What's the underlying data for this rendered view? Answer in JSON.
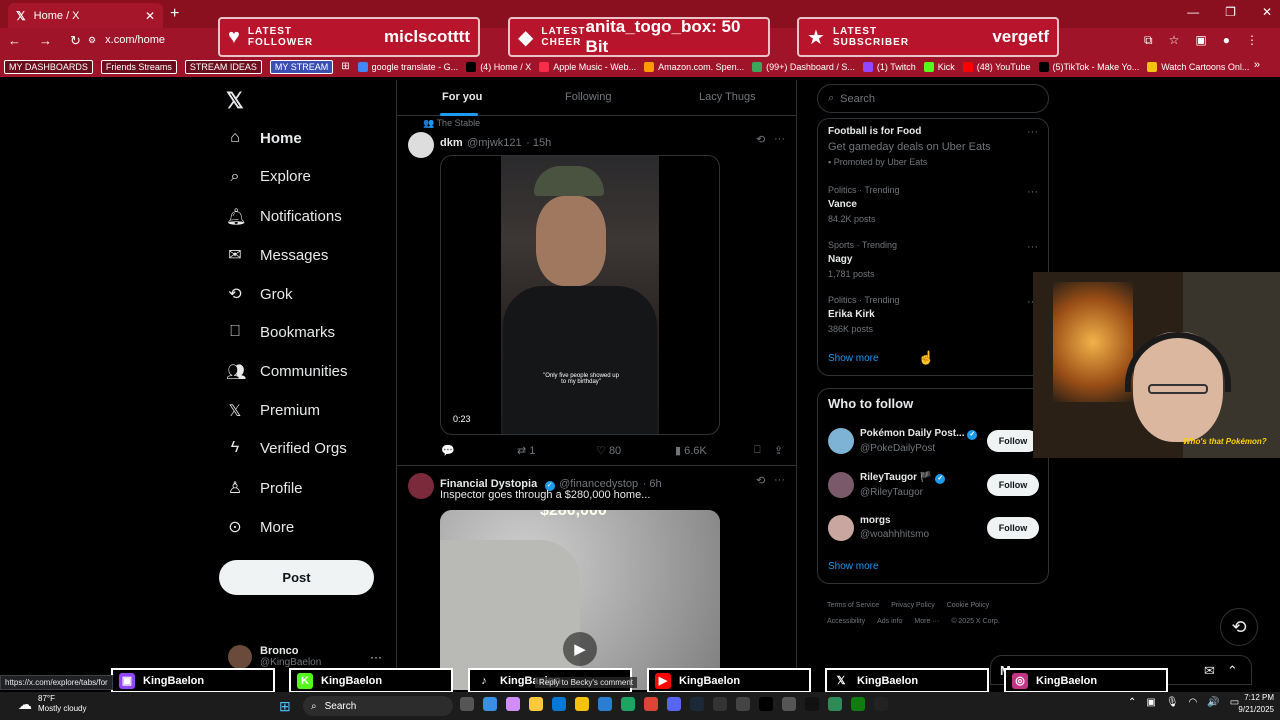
{
  "browser": {
    "tab_title": "Home / X",
    "url": "x.com/home",
    "bookmarks": [
      {
        "label": "MY DASHBOARDS",
        "kind": "tag"
      },
      {
        "label": "Friends Streams",
        "kind": "tag"
      },
      {
        "label": "STREAM IDEAS",
        "kind": "tag"
      },
      {
        "label": "MY STREAM",
        "kind": "tag-blue"
      },
      {
        "label": "google translate - G...",
        "kind": "link",
        "color": "#4285f4"
      },
      {
        "label": "(4) Home / X",
        "kind": "link",
        "color": "#000000"
      },
      {
        "label": "Apple Music - Web...",
        "kind": "link",
        "color": "#fa2d48"
      },
      {
        "label": "Amazon.com. Spen...",
        "kind": "link",
        "color": "#ff9900"
      },
      {
        "label": "(99+) Dashboard / S...",
        "kind": "link",
        "color": "#3ba55c"
      },
      {
        "label": "(1) Twitch",
        "kind": "link",
        "color": "#9146ff"
      },
      {
        "label": "Kick",
        "kind": "link",
        "color": "#53fc18"
      },
      {
        "label": "(48) YouTube",
        "kind": "link",
        "color": "#ff0000"
      },
      {
        "label": "(5)TikTok - Make Yo...",
        "kind": "link",
        "color": "#000000"
      },
      {
        "label": "Watch Cartoons Onl...",
        "kind": "link",
        "color": "#f4c20d"
      }
    ]
  },
  "overlay": {
    "alerts": [
      {
        "top": "LATEST",
        "bottom": "FOLLOWER",
        "name": "miclscotttt",
        "icon": "heart-icon"
      },
      {
        "top": "LATEST",
        "bottom": "CHEER",
        "name": "anita_togo_box: 50 Bit",
        "icon": "diamond-icon"
      },
      {
        "top": "LATEST",
        "bottom": "SUBSCRIBER",
        "name": "vergetf",
        "icon": "star-icon"
      }
    ],
    "socials": [
      {
        "handle": "KingBaelon",
        "platform": "twitch",
        "color": "#9146ff"
      },
      {
        "handle": "KingBaelon",
        "platform": "kick",
        "color": "#53fc18"
      },
      {
        "handle": "KingBaelon",
        "platform": "tiktok",
        "color": "#000000"
      },
      {
        "handle": "KingBaelon",
        "platform": "youtube",
        "color": "#ff0000"
      },
      {
        "handle": "KingBaelon",
        "platform": "x",
        "color": "#000000"
      },
      {
        "handle": "KingBaelon",
        "platform": "instagram",
        "color": "#c13584"
      }
    ],
    "webcam_caption": "Who's that Pokémon?"
  },
  "nav": {
    "items": [
      {
        "label": "Home",
        "icon": "home-icon"
      },
      {
        "label": "Explore",
        "icon": "search-icon"
      },
      {
        "label": "Notifications",
        "icon": "bell-icon"
      },
      {
        "label": "Messages",
        "icon": "mail-icon"
      },
      {
        "label": "Grok",
        "icon": "grok-icon"
      },
      {
        "label": "Bookmarks",
        "icon": "bookmark-icon"
      },
      {
        "label": "Communities",
        "icon": "people-icon"
      },
      {
        "label": "Premium",
        "icon": "x-icon"
      },
      {
        "label": "Verified Orgs",
        "icon": "lightning-icon"
      },
      {
        "label": "Profile",
        "icon": "person-icon"
      },
      {
        "label": "More",
        "icon": "more-circle-icon"
      }
    ],
    "post_label": "Post",
    "profile": {
      "name": "Bronco",
      "handle": "@KingBaelon"
    }
  },
  "feed": {
    "tabs": [
      "For you",
      "Following",
      "Lacy Thugs"
    ],
    "social_context": "The Stable",
    "tweets": [
      {
        "name": "dkm",
        "handle": "@mjwk121",
        "time": "15h",
        "video_duration": "0:23",
        "video_caption": "\"Only five people showed up to my birthday\"",
        "replies": "",
        "reposts": "1",
        "likes": "80",
        "views": "6.6K"
      },
      {
        "name": "Financial Dystopia",
        "handle": "@financedystop",
        "time": "6h",
        "text": "Inspector goes through a $280,000 home...",
        "image_overlay": "$280,000"
      }
    ]
  },
  "sidebar": {
    "search_placeholder": "Search",
    "promoted": {
      "title": "Football is for Food",
      "subtitle": "Get gameday deals on Uber Eats",
      "promoted_by": "Promoted by Uber Eats"
    },
    "trends": [
      {
        "category": "Politics · Trending",
        "title": "Vance",
        "posts": "84.2K posts"
      },
      {
        "category": "Sports · Trending",
        "title": "Nagy",
        "posts": "1,781 posts"
      },
      {
        "category": "Politics · Trending",
        "title": "Erika Kirk",
        "posts": "386K posts"
      }
    ],
    "show_more": "Show more",
    "who_to_follow_title": "Who to follow",
    "follow": [
      {
        "name": "Pokémon Daily Post...",
        "handle": "@PokeDailyPost",
        "verified": true,
        "color": "#7fb3d5"
      },
      {
        "name": "RileyTaugor 🏴",
        "handle": "@RileyTaugor",
        "verified": true,
        "color": "#7a5a6a"
      },
      {
        "name": "morgs",
        "handle": "@woahhhitsmo",
        "verified": false,
        "color": "#c9a7a0"
      }
    ],
    "follow_label": "Follow",
    "footer": [
      "Terms of Service",
      "Privacy Policy",
      "Cookie Policy",
      "Accessibility",
      "Ads info",
      "More ···",
      "© 2025 X Corp."
    ]
  },
  "messages": {
    "title": "Messages"
  },
  "status": {
    "url": "https://x.com/explore/tabs/for",
    "tooltip": "Reply to Becky's comment"
  },
  "taskbar": {
    "weather_temp": "87°F",
    "weather_desc": "Mostly cloudy",
    "search": "Search",
    "time": "7:12 PM",
    "date": "9/21/2025"
  }
}
